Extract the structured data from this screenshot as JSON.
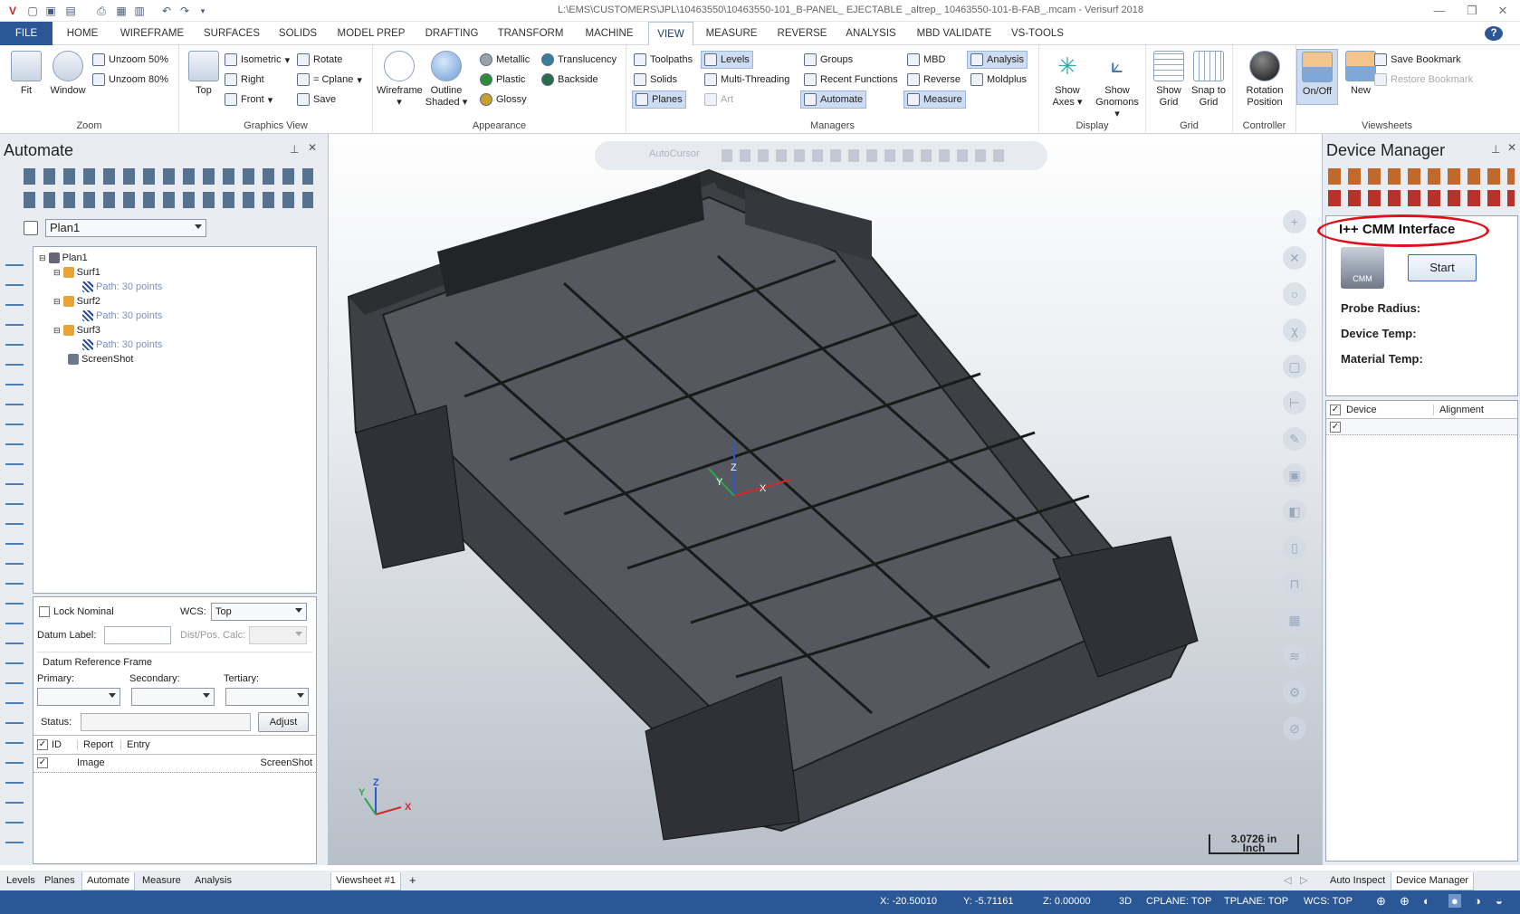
{
  "titlebar": {
    "title": "L:\\EMS\\CUSTOMERS\\JPL\\10463550\\10463550-101_B-PANEL_ EJECTABLE _altrep_ 10463550-101-B-FAB_.mcam - Verisurf 2018",
    "minimize": "—",
    "restore": "❐",
    "close": "✕"
  },
  "menu": {
    "tabs": [
      "FILE",
      "HOME",
      "WIREFRAME",
      "SURFACES",
      "SOLIDS",
      "MODEL PREP",
      "DRAFTING",
      "TRANSFORM",
      "MACHINE",
      "VIEW",
      "MEASURE",
      "REVERSE",
      "ANALYSIS",
      "MBD VALIDATE",
      "VS-TOOLS"
    ],
    "active": "VIEW",
    "help": "?"
  },
  "ribbon": {
    "zoom": {
      "label": "Zoom",
      "fit": "Fit",
      "window": "Window",
      "unzoom50": "Unzoom 50%",
      "unzoom80": "Unzoom 80%"
    },
    "graphics_view": {
      "label": "Graphics View",
      "top": "Top",
      "isometric": "Isometric",
      "right": "Right",
      "front": "Front",
      "rotate": "Rotate",
      "cplane": "= Cplane",
      "save": "Save"
    },
    "appearance": {
      "label": "Appearance",
      "wireframe": "Wireframe",
      "outline_shaded": "Outline Shaded",
      "metallic": "Metallic",
      "plastic": "Plastic",
      "glossy": "Glossy",
      "translucency": "Translucency",
      "backside": "Backside"
    },
    "managers": {
      "label": "Managers",
      "toolpaths": "Toolpaths",
      "solids": "Solids",
      "planes": "Planes",
      "levels": "Levels",
      "multithreading": "Multi-Threading",
      "art": "Art",
      "groups": "Groups",
      "recent_functions": "Recent Functions",
      "automate": "Automate",
      "mbd": "MBD",
      "reverse": "Reverse",
      "measure": "Measure",
      "analysis": "Analysis",
      "moldplus": "Moldplus"
    },
    "display": {
      "label": "Display",
      "show_axes": "Show Axes",
      "show_gnomons": "Show Gnomons"
    },
    "grid": {
      "label": "Grid",
      "show_grid": "Show Grid",
      "snap_to_grid": "Snap to Grid"
    },
    "controller": {
      "label": "Controller",
      "rotation_position": "Rotation Position"
    },
    "viewsheets": {
      "label": "Viewsheets",
      "onoff": "On/Off",
      "new": "New",
      "save_bookmark": "Save Bookmark",
      "restore_bookmark": "Restore Bookmark"
    }
  },
  "automate": {
    "title": "Automate",
    "plan_select": "Plan1",
    "tree": [
      {
        "label": "Plan1",
        "kind": "plan"
      },
      {
        "label": "Surf1",
        "kind": "surf"
      },
      {
        "label": "Path: 30 points",
        "kind": "path"
      },
      {
        "label": "Surf2",
        "kind": "surf"
      },
      {
        "label": "Path: 30 points",
        "kind": "path"
      },
      {
        "label": "Surf3",
        "kind": "surf"
      },
      {
        "label": "Path: 30 points",
        "kind": "path"
      },
      {
        "label": "ScreenShot",
        "kind": "shot"
      }
    ],
    "lock_nominal": "Lock Nominal",
    "wcs_label": "WCS:",
    "wcs_value": "Top",
    "datum_label": "Datum Label:",
    "dist_label": "Dist/Pos. Calc:",
    "drf_label": "Datum Reference Frame",
    "primary": "Primary:",
    "secondary": "Secondary:",
    "tertiary": "Tertiary:",
    "status_label": "Status:",
    "adjust": "Adjust",
    "grid_headers": [
      "ID",
      "Report",
      "Entry"
    ],
    "grid_rows": [
      {
        "report": "Image",
        "entry": "ScreenShot"
      }
    ]
  },
  "left_tabs": [
    "Levels",
    "Planes",
    "Automate",
    "Measure",
    "Analysis"
  ],
  "left_tab_active": "Automate",
  "viewport": {
    "autocursor": "AutoCursor",
    "scale_value": "3.0726 in",
    "scale_unit": "Inch",
    "axis_x": "X",
    "axis_y": "Y",
    "axis_z": "Z"
  },
  "viewsheet_tab": "Viewsheet #1",
  "viewsheet_add": "+",
  "device_manager": {
    "title": "Device Manager",
    "interface": "I++ CMM Interface",
    "cmm_logo_text": "CMM",
    "start": "Start",
    "probe_radius": "Probe Radius:",
    "device_temp": "Device Temp:",
    "material_temp": "Material Temp:",
    "grid_headers": [
      "Device",
      "Alignment"
    ],
    "highlight_color": "#e0101a"
  },
  "right_tabs": [
    "Auto Inspect",
    "Device Manager"
  ],
  "right_tab_active": "Device Manager",
  "status": {
    "x": "X:   -20.50010",
    "y": "Y:   -5.71161",
    "z": "Z:   0.00000",
    "mode": "3D",
    "cplane": "CPLANE: TOP",
    "tplane": "TPLANE: TOP",
    "wcs": "WCS: TOP"
  },
  "colors": {
    "accent": "#2b5797",
    "file_tab": "#2b5797",
    "part": "#4a4d52"
  }
}
